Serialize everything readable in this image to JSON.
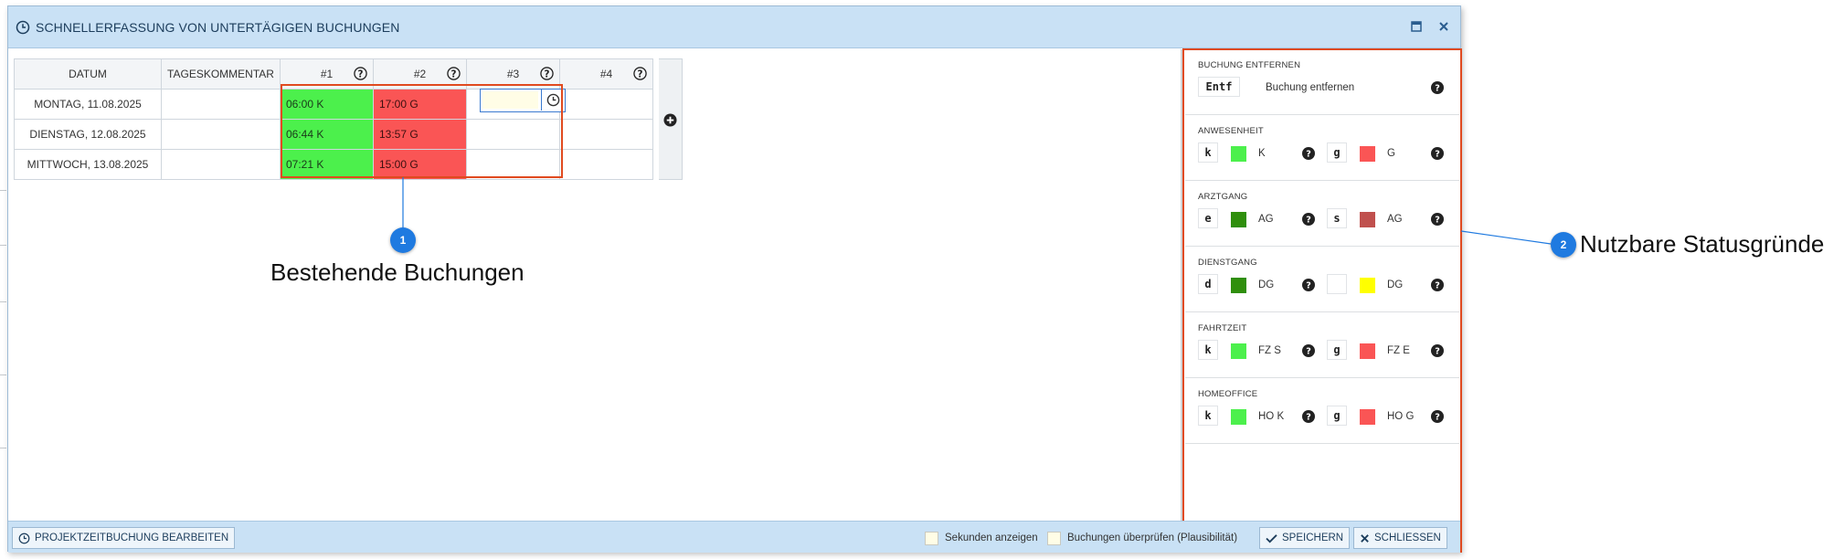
{
  "window": {
    "title": "SCHNELLERFASSUNG VON UNTERTÄGIGEN BUCHUNGEN",
    "maximize_icon": "maximize-icon",
    "close_icon": "close-icon"
  },
  "table": {
    "headers": [
      "DATUM",
      "TAGESKOMMENTAR",
      "#1",
      "#2",
      "#3",
      "#4"
    ],
    "rows": [
      {
        "date": "MONTAG, 11.08.2025",
        "comment": "",
        "slot1": "06:00 K",
        "slot2": "17:00 G",
        "slot3": "",
        "slot4": ""
      },
      {
        "date": "DIENSTAG, 12.08.2025",
        "comment": "",
        "slot1": "06:44 K",
        "slot2": "13:57 G",
        "slot3": "",
        "slot4": ""
      },
      {
        "date": "MITTWOCH, 13.08.2025",
        "comment": "",
        "slot1": "07:21 K",
        "slot2": "15:00 G",
        "slot3": "",
        "slot4": ""
      }
    ],
    "slot_colors": {
      "kommen": "#4cf04c",
      "gehen": "#fa5555"
    }
  },
  "panel": {
    "remove": {
      "title": "BUCHUNG ENTFERNEN",
      "key": "Entf",
      "label": "Buchung entfernen"
    },
    "sections": [
      {
        "title": "ANWESENHEIT",
        "a_key": "k",
        "a_color": "#4cf04c",
        "a_label": "K",
        "b_key": "g",
        "b_color": "#fa5555",
        "b_label": "G"
      },
      {
        "title": "ARZTGANG",
        "a_key": "e",
        "a_color": "#2f8f0c",
        "a_label": "AG",
        "b_key": "s",
        "b_color": "#c0504d",
        "b_label": "AG"
      },
      {
        "title": "DIENSTGANG",
        "a_key": "d",
        "a_color": "#2f8f0c",
        "a_label": "DG",
        "b_key": "",
        "b_color": "#ffff00",
        "b_label": "DG"
      },
      {
        "title": "FAHRTZEIT",
        "a_key": "k",
        "a_color": "#4cf04c",
        "a_label": "FZ S",
        "b_key": "g",
        "b_color": "#fa5555",
        "b_label": "FZ E"
      },
      {
        "title": "HOMEOFFICE",
        "a_key": "k",
        "a_color": "#4cf04c",
        "a_label": "HO K",
        "b_key": "g",
        "b_color": "#fa5555",
        "b_label": "HO G"
      }
    ]
  },
  "footer": {
    "project_button": "PROJEKTZEITBUCHUNG BEARBEITEN",
    "seconds_label": "Sekunden anzeigen",
    "check_label": "Buchungen überprüfen (Plausibilität)",
    "save_button": "SPEICHERN",
    "close_button": "SCHLIESSEN"
  },
  "annotations": {
    "one": {
      "number": "1",
      "text": "Bestehende Buchungen",
      "color": "#1f7ae0"
    },
    "two": {
      "number": "2",
      "text": "Nutzbare Statusgründe",
      "color": "#1f7ae0"
    },
    "highlight_color": "#e04a1f"
  }
}
